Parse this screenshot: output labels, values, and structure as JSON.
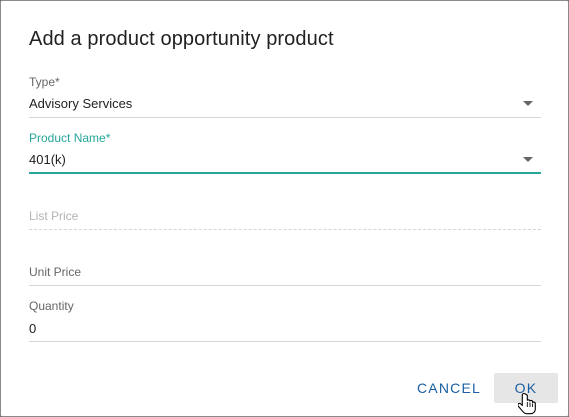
{
  "dialog": {
    "title": "Add a product opportunity product"
  },
  "fields": {
    "type": {
      "label": "Type*",
      "value": "Advisory Services"
    },
    "product_name": {
      "label": "Product Name*",
      "value": "401(k)"
    },
    "list_price": {
      "label": "List Price",
      "value": ""
    },
    "unit_price": {
      "label": "Unit Price",
      "value": ""
    },
    "quantity": {
      "label": "Quantity",
      "value": "0"
    }
  },
  "buttons": {
    "cancel": "CANCEL",
    "ok": "OK"
  },
  "colors": {
    "accent": "#26a69a",
    "button_text": "#1b5fa3"
  }
}
